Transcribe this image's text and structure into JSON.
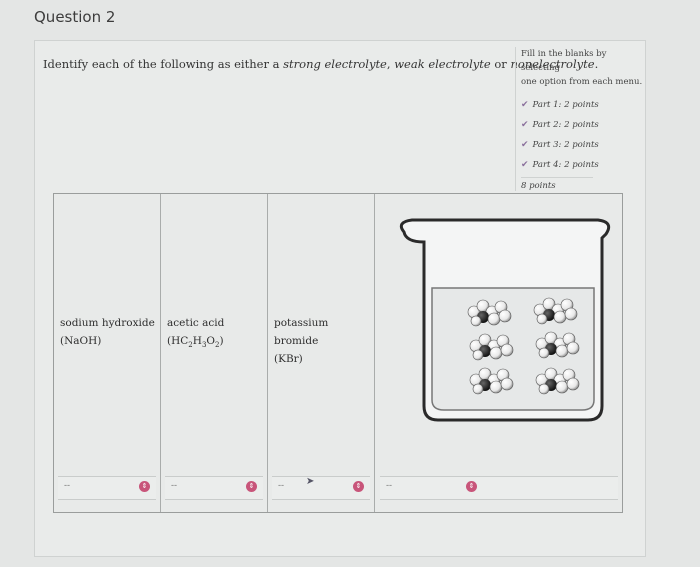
{
  "question_title": "Question 2",
  "prompt": {
    "before": "Identify each of the following as either a ",
    "strong": "strong electrolyte",
    "middle": ", ",
    "weak": "weak electrolyte",
    "or": " or ",
    "non": "nonelectrolyte",
    "end": "."
  },
  "sidebar": {
    "intro_line1": "Fill in the blanks by selecting",
    "intro_line2": "one option from each menu.",
    "parts": [
      {
        "label": "Part 1: 2 points"
      },
      {
        "label": "Part 2: 2 points"
      },
      {
        "label": "Part 3: 2 points"
      },
      {
        "label": "Part 4: 2 points"
      }
    ],
    "total": "8 points",
    "check_icon_color": "#8a6f9c"
  },
  "columns": [
    {
      "name": "sodium hydroxide",
      "formula": "(NaOH)"
    },
    {
      "name": "acetic acid",
      "formula_parts": [
        "(HC",
        "2",
        "H",
        "3",
        "O",
        "2",
        ")"
      ]
    },
    {
      "name": "potassium bromide",
      "formula": "(KBr)"
    }
  ],
  "dropdowns": [
    {
      "value": "--"
    },
    {
      "value": "--"
    },
    {
      "value": "--"
    },
    {
      "value": "--"
    }
  ],
  "dropdown_icon": "chevron-updown-icon",
  "accent_color": "#c8557a"
}
